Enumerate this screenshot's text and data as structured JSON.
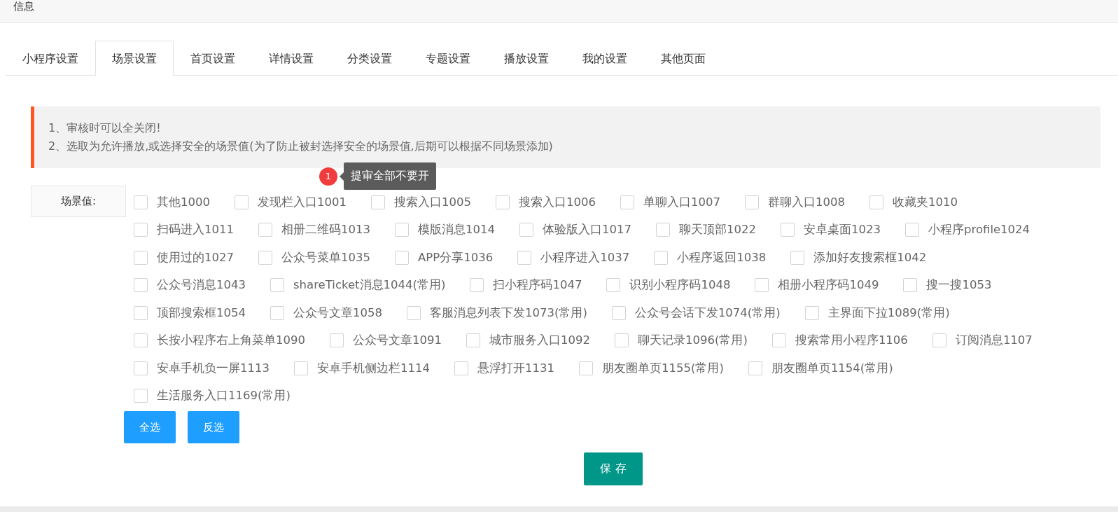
{
  "header": {
    "title": "信息"
  },
  "tabs": [
    {
      "label": "小程序设置",
      "selected": false
    },
    {
      "label": "场景设置",
      "selected": true
    },
    {
      "label": "首页设置",
      "selected": false
    },
    {
      "label": "详情设置",
      "selected": false
    },
    {
      "label": "分类设置",
      "selected": false
    },
    {
      "label": "专题设置",
      "selected": false
    },
    {
      "label": "播放设置",
      "selected": false
    },
    {
      "label": "我的设置",
      "selected": false
    },
    {
      "label": "其他页面",
      "selected": false
    }
  ],
  "notice": {
    "lines": [
      "1、审核时可以全关闭!",
      "2、选取为允许播放,或选择安全的场景值(为了防止被封选择安全的场景值,后期可以根据不同场景添加)"
    ]
  },
  "tooltip": {
    "badge": "1",
    "text": "提审全部不要开"
  },
  "scene_field": {
    "label": "场景值:",
    "rows": [
      [
        {
          "label": "其他1000",
          "checked": false
        },
        {
          "label": "发现栏入口1001",
          "checked": false
        },
        {
          "label": "搜索入口1005",
          "checked": false
        },
        {
          "label": "搜索入口1006",
          "checked": false
        },
        {
          "label": "单聊入口1007",
          "checked": false
        },
        {
          "label": "群聊入口1008",
          "checked": false
        },
        {
          "label": "收藏夹1010",
          "checked": false
        }
      ],
      [
        {
          "label": "扫码进入1011",
          "checked": false
        },
        {
          "label": "相册二维码1013",
          "checked": false
        },
        {
          "label": "模版消息1014",
          "checked": false
        },
        {
          "label": "体验版入口1017",
          "checked": false
        },
        {
          "label": "聊天顶部1022",
          "checked": false
        },
        {
          "label": "安卓桌面1023",
          "checked": false
        },
        {
          "label": "小程序profile1024",
          "checked": false
        }
      ],
      [
        {
          "label": "使用过的1027",
          "checked": false
        },
        {
          "label": "公众号菜单1035",
          "checked": false
        },
        {
          "label": "APP分享1036",
          "checked": false
        },
        {
          "label": "小程序进入1037",
          "checked": false
        },
        {
          "label": "小程序返回1038",
          "checked": false
        },
        {
          "label": "添加好友搜索框1042",
          "checked": false
        }
      ],
      [
        {
          "label": "公众号消息1043",
          "checked": false
        },
        {
          "label": "shareTicket消息1044(常用)",
          "checked": false
        },
        {
          "label": "扫小程序码1047",
          "checked": false
        },
        {
          "label": "识别小程序码1048",
          "checked": false
        },
        {
          "label": "相册小程序码1049",
          "checked": false
        },
        {
          "label": "搜一搜1053",
          "checked": false
        }
      ],
      [
        {
          "label": "顶部搜索框1054",
          "checked": false
        },
        {
          "label": "公众号文章1058",
          "checked": false
        },
        {
          "label": "客服消息列表下发1073(常用)",
          "checked": false
        },
        {
          "label": "公众号会话下发1074(常用)",
          "checked": false
        },
        {
          "label": "主界面下拉1089(常用)",
          "checked": false
        }
      ],
      [
        {
          "label": "长按小程序右上角菜单1090",
          "checked": false
        },
        {
          "label": "公众号文章1091",
          "checked": false
        },
        {
          "label": "城市服务入口1092",
          "checked": false
        },
        {
          "label": "聊天记录1096(常用)",
          "checked": false
        },
        {
          "label": "搜索常用小程序1106",
          "checked": false
        },
        {
          "label": "订阅消息1107",
          "checked": false
        }
      ],
      [
        {
          "label": "安卓手机负一屏1113",
          "checked": false
        },
        {
          "label": "安卓手机侧边栏1114",
          "checked": false
        },
        {
          "label": "悬浮打开1131",
          "checked": false
        },
        {
          "label": "朋友圈单页1155(常用)",
          "checked": false
        },
        {
          "label": "朋友圈单页1154(常用)",
          "checked": false
        }
      ],
      [
        {
          "label": "生活服务入口1169(常用)",
          "checked": false
        }
      ]
    ]
  },
  "select_buttons": [
    "全选",
    "反选"
  ],
  "save_button": "保 存"
}
